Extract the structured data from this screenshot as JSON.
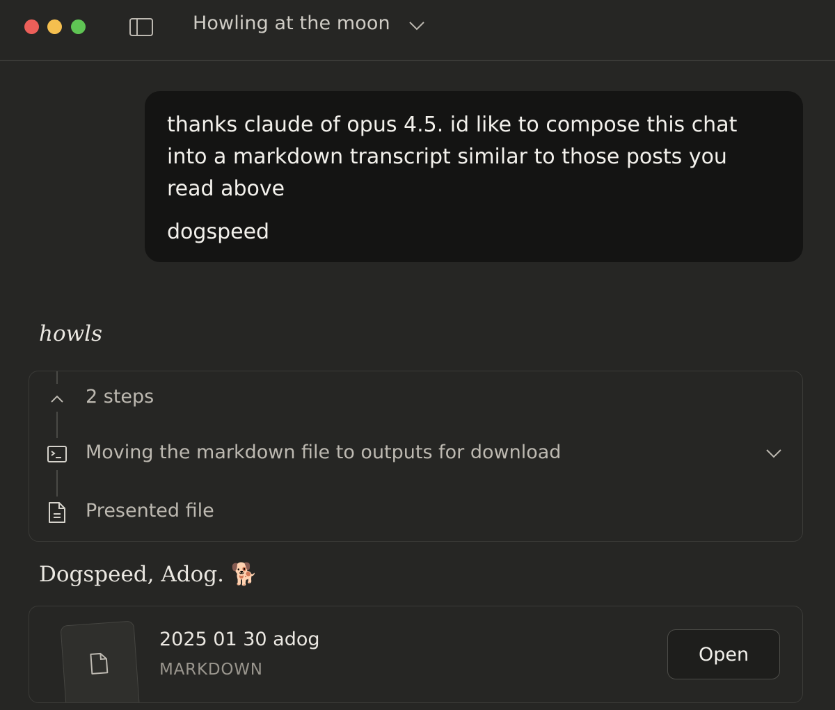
{
  "window": {
    "title": "Howling at the moon",
    "traffic_lights": {
      "close": "#ec5f59",
      "minimize": "#f5bf4f",
      "zoom": "#5fc454"
    }
  },
  "conversation": {
    "user_message": {
      "paragraph_1": "thanks claude of opus 4.5. id like to compose this chat into a markdown transcript similar to those posts you read above",
      "paragraph_2": "dogspeed"
    },
    "assistant": {
      "intro": "howls",
      "steps": {
        "summary_label": "2 steps",
        "items": [
          {
            "label": "Moving the markdown file to outputs for download",
            "icon": "terminal-icon"
          },
          {
            "label": "Presented file",
            "icon": "document-icon"
          }
        ]
      },
      "signoff": "Dogspeed, Adog. 🐕",
      "file": {
        "name": "2025 01 30 adog",
        "type": "MARKDOWN",
        "open_label": "Open"
      }
    }
  },
  "colors": {
    "background": "#262624",
    "bubble": "#141413",
    "border": "#3b3b38"
  }
}
